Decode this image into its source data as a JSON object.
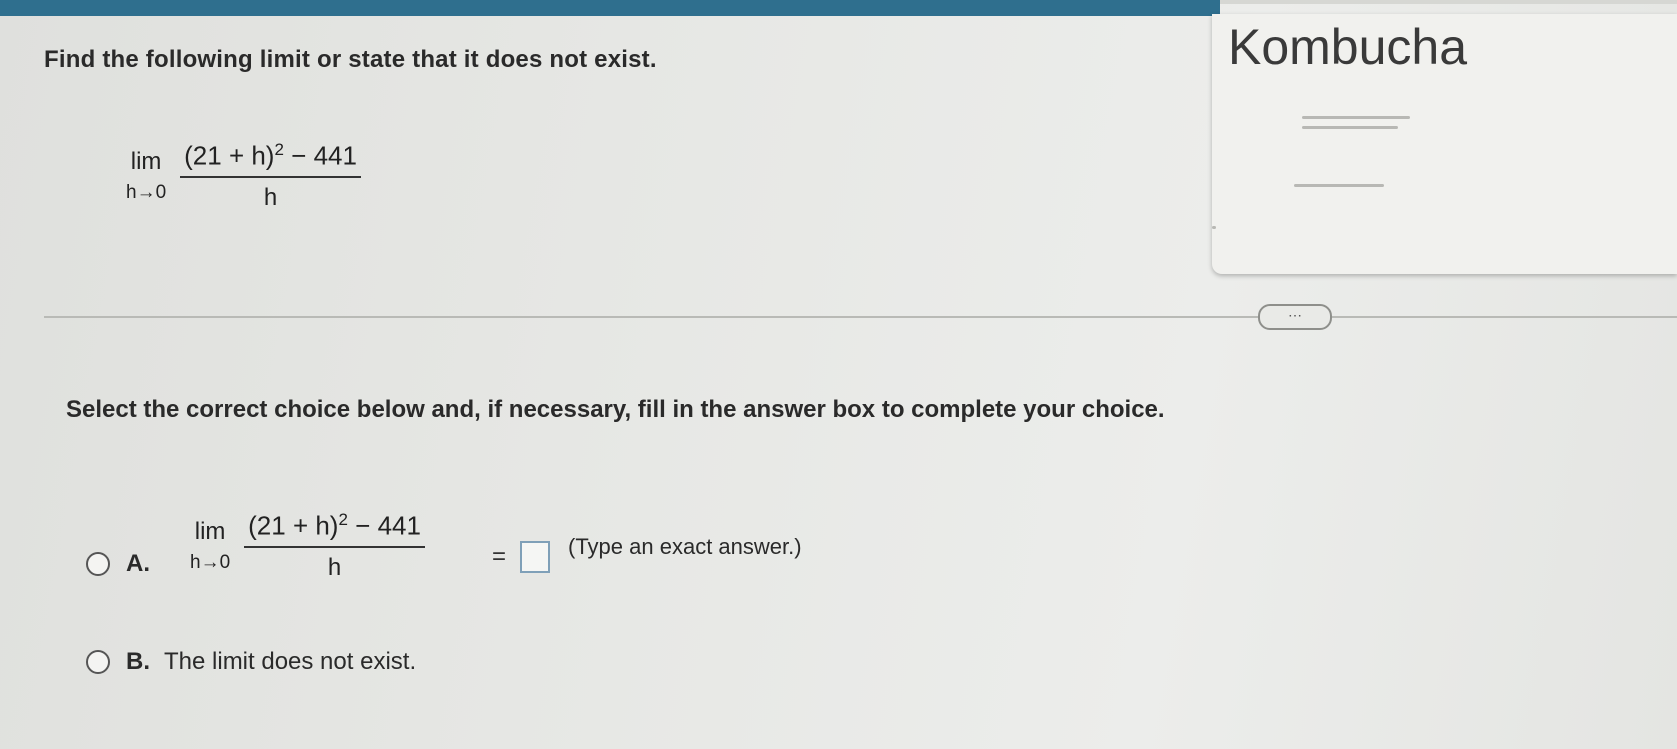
{
  "question": {
    "text": "Find the following limit or state that it does not exist."
  },
  "limit": {
    "word": "lim",
    "subscript": "h→0",
    "numerator": "(21 + h)",
    "exponent": "2",
    "numerator_tail": " − 441",
    "denominator": "h"
  },
  "ad": {
    "title": "Kombucha"
  },
  "more_button": {
    "label": "⋯"
  },
  "instruction": "Select the correct choice below and, if necessary, fill in the answer box to complete your choice.",
  "choices": {
    "a": {
      "letter": "A.",
      "equals": "=",
      "hint": "(Type an exact answer.)"
    },
    "b": {
      "letter": "B.",
      "text": "The limit does not exist."
    }
  },
  "colors": {
    "header": "#2f6f8e",
    "answer_box_border": "#7fa0b8"
  }
}
